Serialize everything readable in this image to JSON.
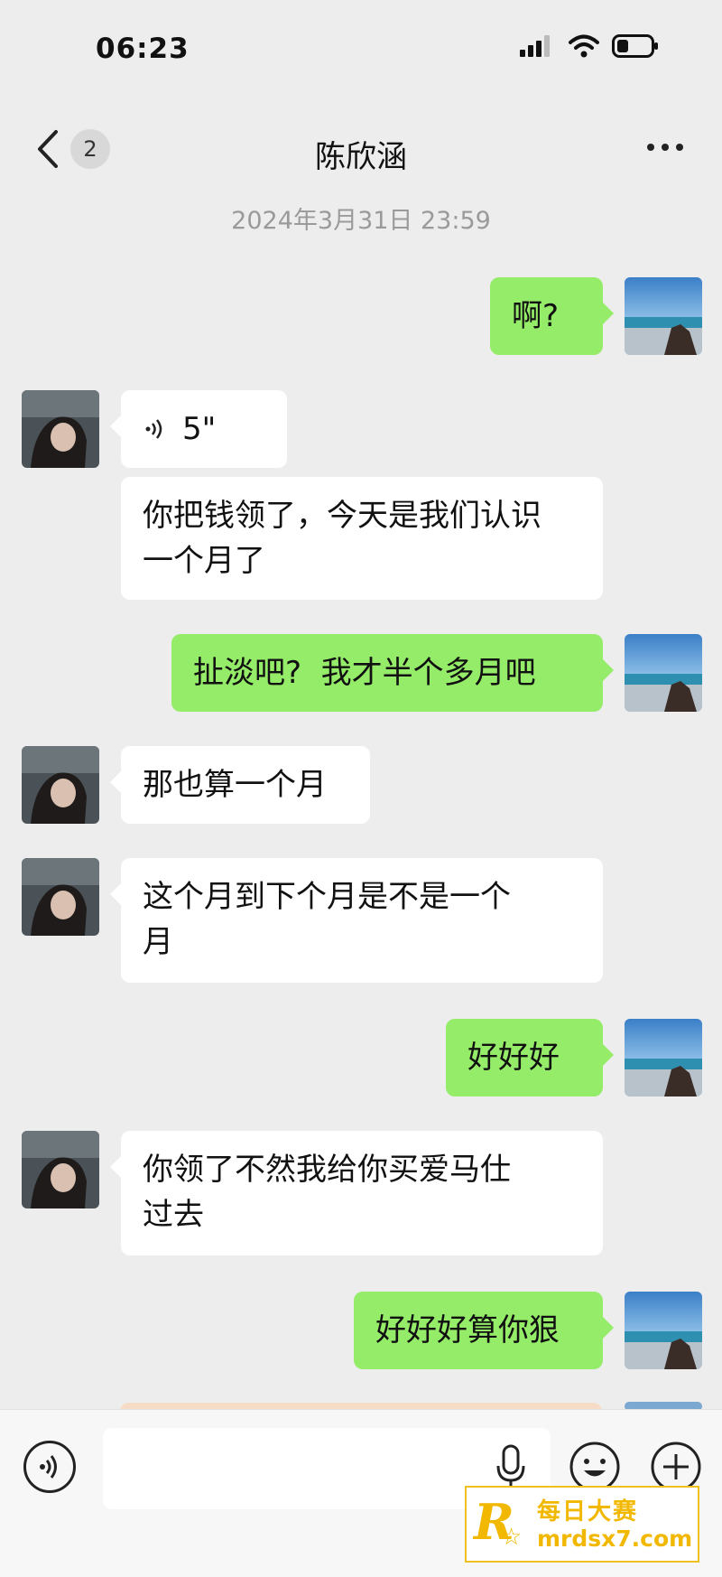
{
  "status_bar": {
    "time": "06:23"
  },
  "header": {
    "unread_count": "2",
    "contact_name": "陈欣涵"
  },
  "timestamp": "2024年3月31日 23:59",
  "messages": [
    {
      "side": "out",
      "text": "啊?"
    },
    {
      "side": "in",
      "type": "voice",
      "duration": "5\""
    },
    {
      "side": "in",
      "text_line1": "你把钱领了，今天是我们认识",
      "text_line2": "一个月了"
    },
    {
      "side": "out",
      "text": "扯淡吧?  我才半个多月吧"
    },
    {
      "side": "in",
      "text": "那也算一个月"
    },
    {
      "side": "in",
      "text_line1": "这个月到下个月是不是一个",
      "text_line2": "月"
    },
    {
      "side": "out",
      "text": "好好好"
    },
    {
      "side": "in",
      "text_line1": "你领了不然我给你买爱马仕",
      "text_line2": "过去"
    },
    {
      "side": "out",
      "text": "好好好算你狠"
    }
  ],
  "input_bar": {
    "placeholder": ""
  },
  "watermark": {
    "logo_letter": "R",
    "text": "每日大赛",
    "url": "mrdsx7.com"
  },
  "colors": {
    "background": "#ededed",
    "outgoing_bubble": "#95ec69",
    "incoming_bubble": "#ffffff"
  },
  "icons": [
    "signal-icon",
    "wifi-icon",
    "battery-icon",
    "back-chevron-icon",
    "more-icon",
    "voice-mode-icon",
    "microphone-icon",
    "emoji-icon",
    "plus-icon"
  ]
}
